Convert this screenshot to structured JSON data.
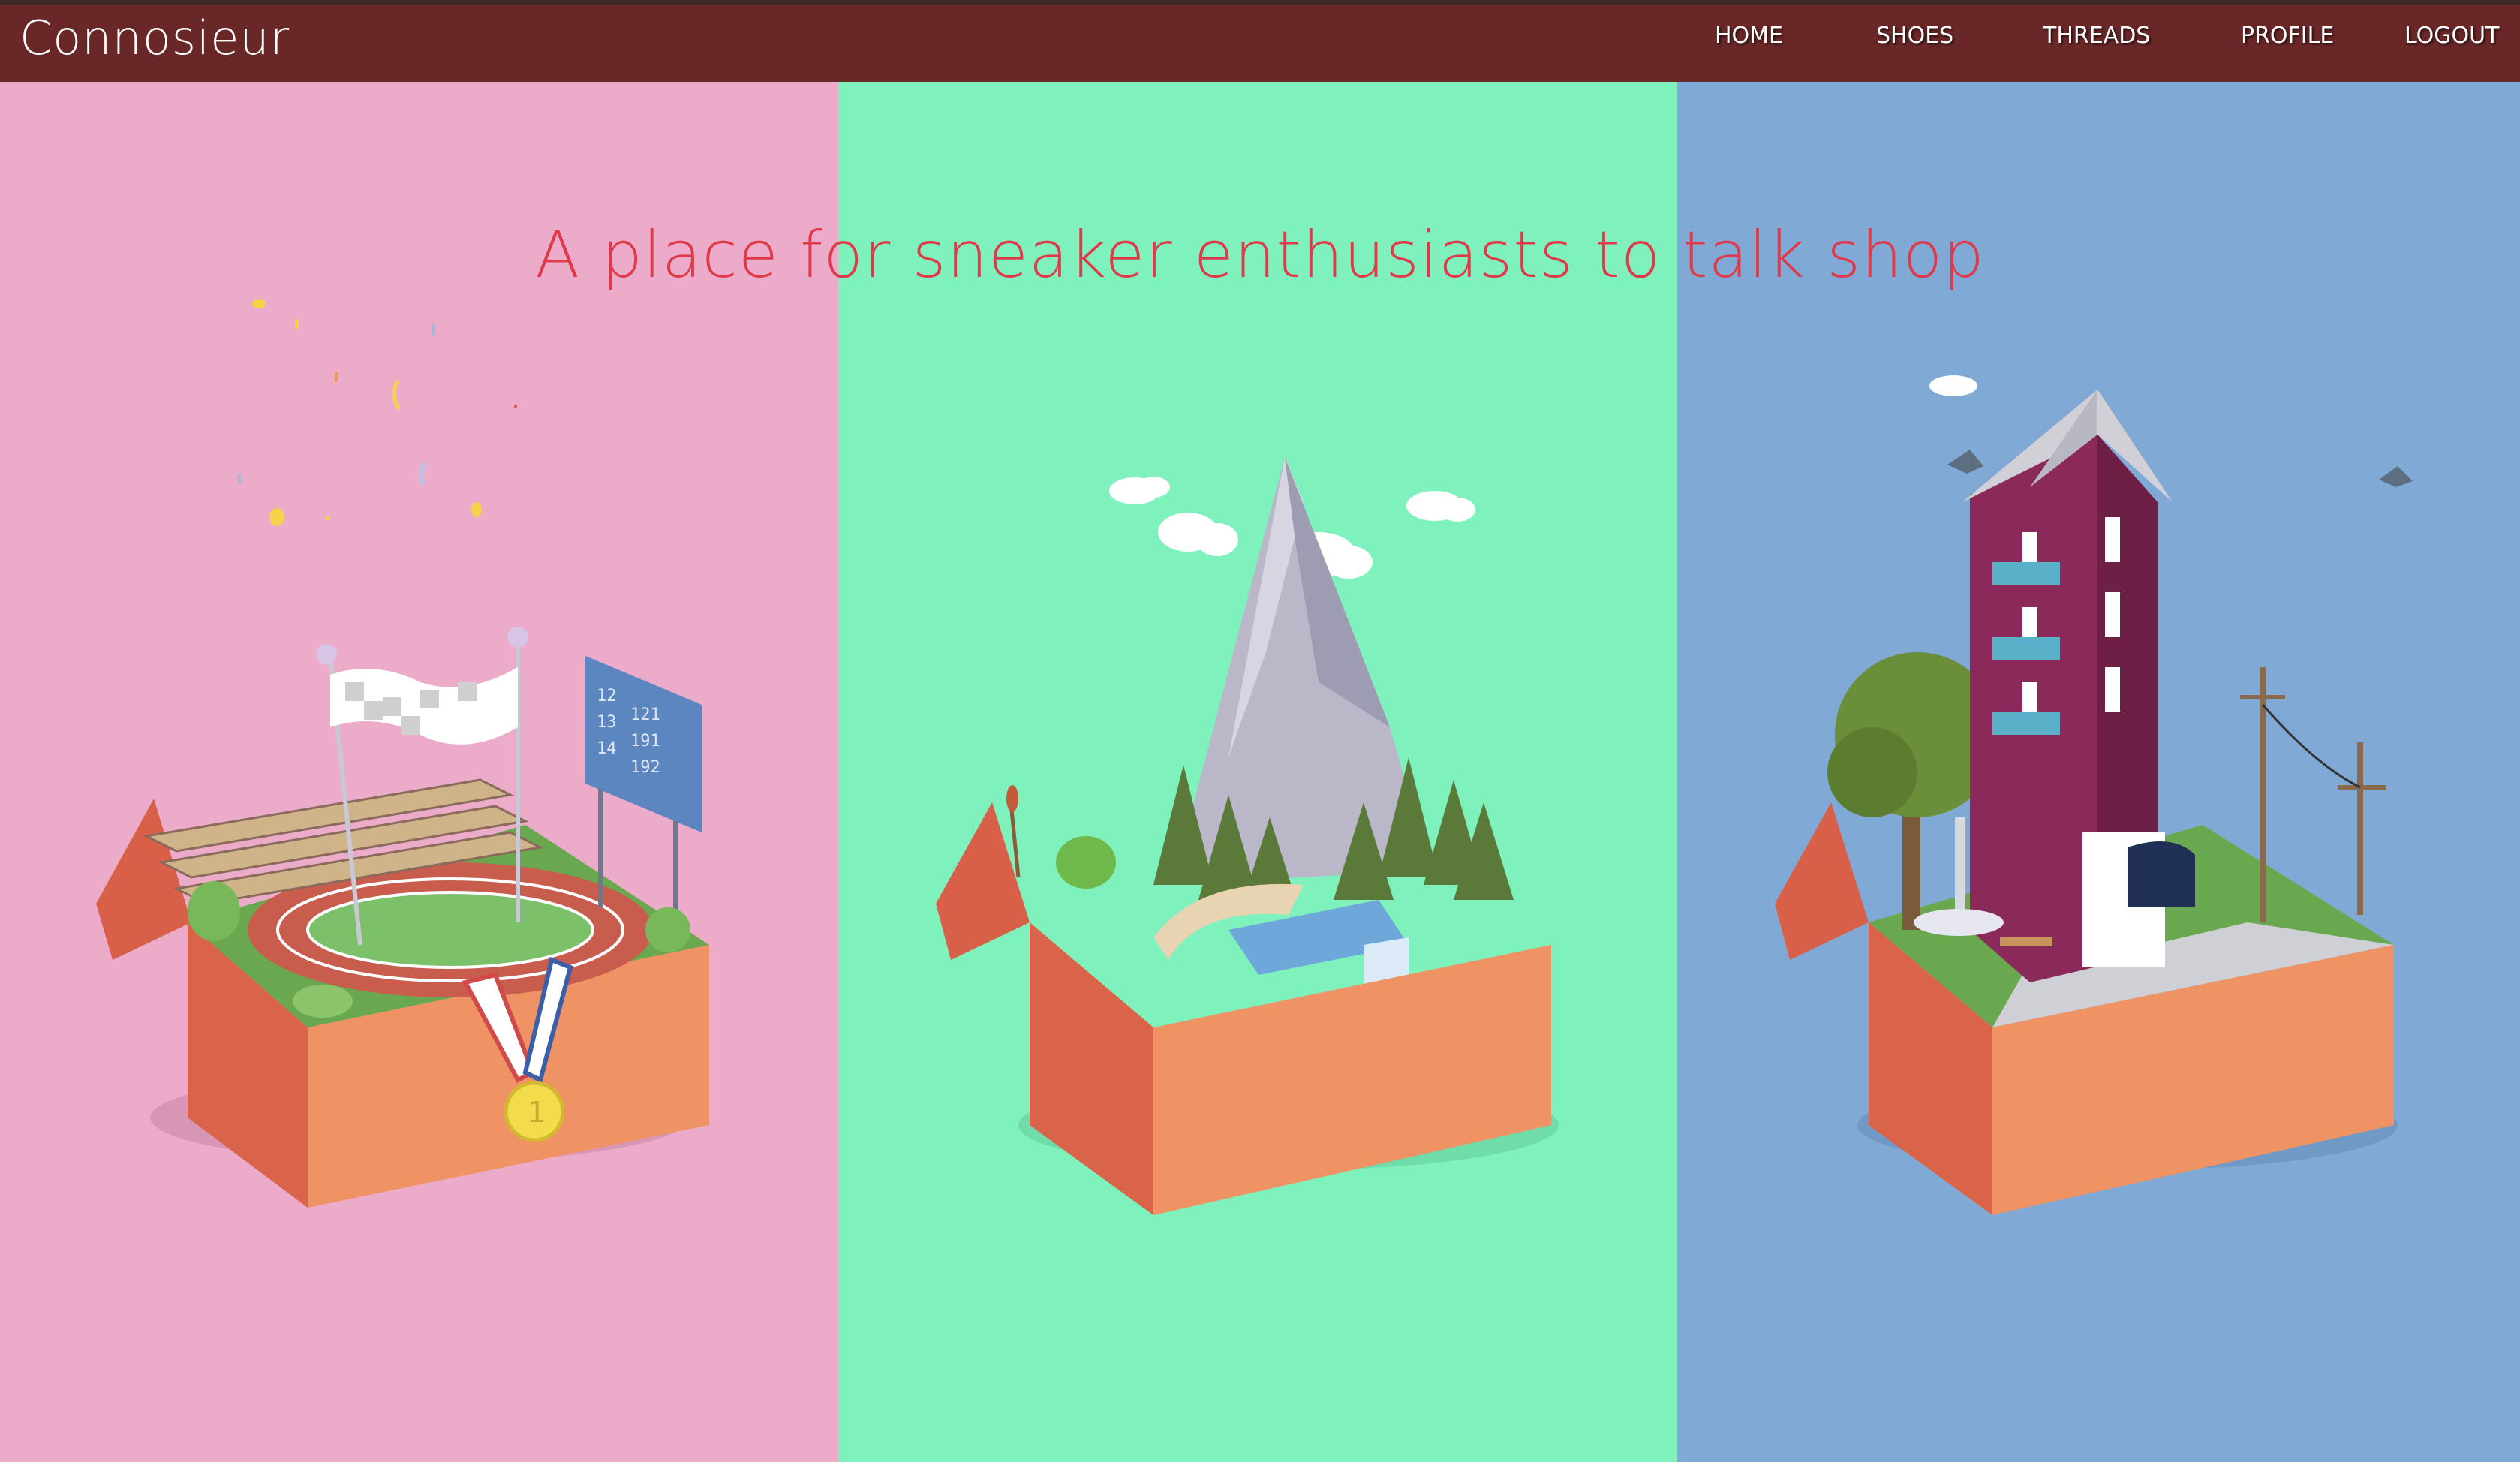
{
  "app": {
    "brand": "Connosieur"
  },
  "nav": {
    "items": [
      {
        "label": "HOME"
      },
      {
        "label": "SHOES"
      },
      {
        "label": "THREADS"
      },
      {
        "label": "PROFILE"
      },
      {
        "label": "LOGOUT"
      }
    ]
  },
  "hero": {
    "tagline": "A place for sneaker enthusiasts to talk shop",
    "panels": [
      {
        "scene": "track-stadium-in-shoebox",
        "color": "#ebabc9"
      },
      {
        "scene": "mountain-forest-in-shoebox",
        "color": "#7ff1bd"
      },
      {
        "scene": "city-building-in-shoebox",
        "color": "#80aad5"
      }
    ],
    "scoreboard": [
      "12",
      "121",
      "13",
      "191",
      "14",
      "192"
    ],
    "medal_number": "1"
  },
  "colors": {
    "navbar": "#6a2727",
    "tagline": "#e0394a",
    "box": "#ef9264"
  }
}
